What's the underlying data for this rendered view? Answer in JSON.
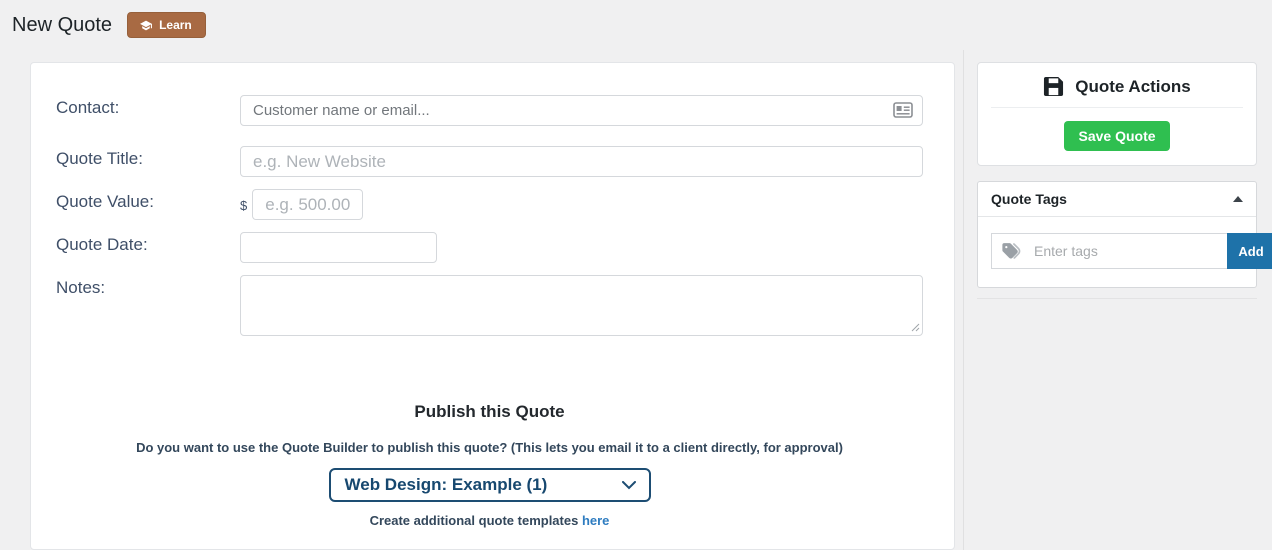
{
  "header": {
    "title": "New Quote",
    "learn_button": "Learn"
  },
  "form": {
    "contact": {
      "label": "Contact:",
      "placeholder": "Customer name or email...",
      "value": ""
    },
    "quote_title": {
      "label": "Quote Title:",
      "placeholder": "e.g. New Website",
      "value": ""
    },
    "quote_value": {
      "label": "Quote Value:",
      "currency_symbol": "$",
      "placeholder": "e.g. 500.00",
      "value": ""
    },
    "quote_date": {
      "label": "Quote Date:",
      "value": ""
    },
    "notes": {
      "label": "Notes:",
      "value": ""
    }
  },
  "publish": {
    "heading": "Publish this Quote",
    "question": "Do you want to use the Quote Builder to publish this quote? (This lets you email it to a client directly, for approval)",
    "selected_template": "Web Design: Example (1)",
    "create_more_prefix": "Create additional quote templates",
    "create_more_link": "here"
  },
  "sidebar": {
    "quote_actions": {
      "title": "Quote Actions",
      "save_button": "Save Quote"
    },
    "quote_tags": {
      "title": "Quote Tags",
      "input_placeholder": "Enter tags",
      "add_button": "Add"
    }
  },
  "colors": {
    "page_bg": "#f0f0f1",
    "label_text": "#3f4f68",
    "learn_button_bg": "#a86a43",
    "save_button_bg": "#2fbf50",
    "add_button_bg": "#1e72a9",
    "select_border": "#1d4d73",
    "select_text": "#17486f",
    "link_blue": "#2e7cc0"
  }
}
